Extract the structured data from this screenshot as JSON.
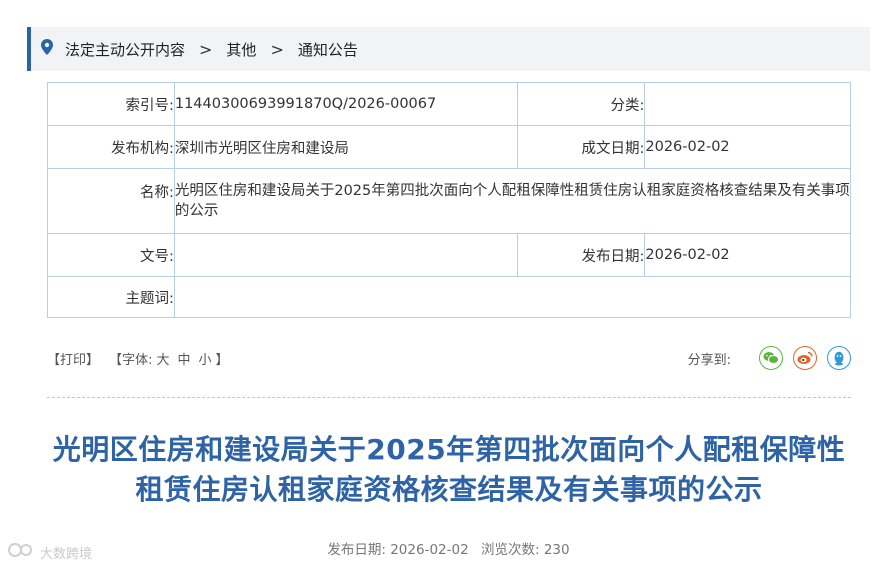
{
  "breadcrumb": {
    "items": [
      "法定主动公开内容",
      "其他",
      "通知公告"
    ],
    "separator": ">"
  },
  "meta": {
    "index_label": "索引号:",
    "index_value": "11440300693991870Q/2026-00067",
    "category_label": "分类:",
    "category_value": "",
    "publisher_label": "发布机构:",
    "publisher_value": "深圳市光明区住房和建设局",
    "written_date_label": "成文日期:",
    "written_date_value": "2026-02-02",
    "name_label": "名称:",
    "name_value": "光明区住房和建设局关于2025年第四批次面向个人配租保障性租赁住房认租家庭资格核查结果及有关事项的公示",
    "doc_no_label": "文号:",
    "doc_no_value": "",
    "publish_date_label": "发布日期:",
    "publish_date_value": "2026-02-02",
    "subject_label": "主题词:",
    "subject_value": ""
  },
  "tools": {
    "print": "打印",
    "font_label": "字体:",
    "font_large": "大",
    "font_medium": "中",
    "font_small": "小",
    "share_label": "分享到:"
  },
  "article": {
    "title": "光明区住房和建设局关于2025年第四批次面向个人配租保障性租赁住房认租家庭资格核查结果及有关事项的公示",
    "publish_label": "发布日期:",
    "publish_date": "2026-02-02",
    "views_label": "浏览次数:",
    "views": "230"
  },
  "watermark": "大数跨境",
  "colors": {
    "accent": "#2a64a8",
    "title": "#2e63a6",
    "wechat": "#5bb53c",
    "weibo": "#e6622a",
    "qq": "#2d9ad9"
  }
}
